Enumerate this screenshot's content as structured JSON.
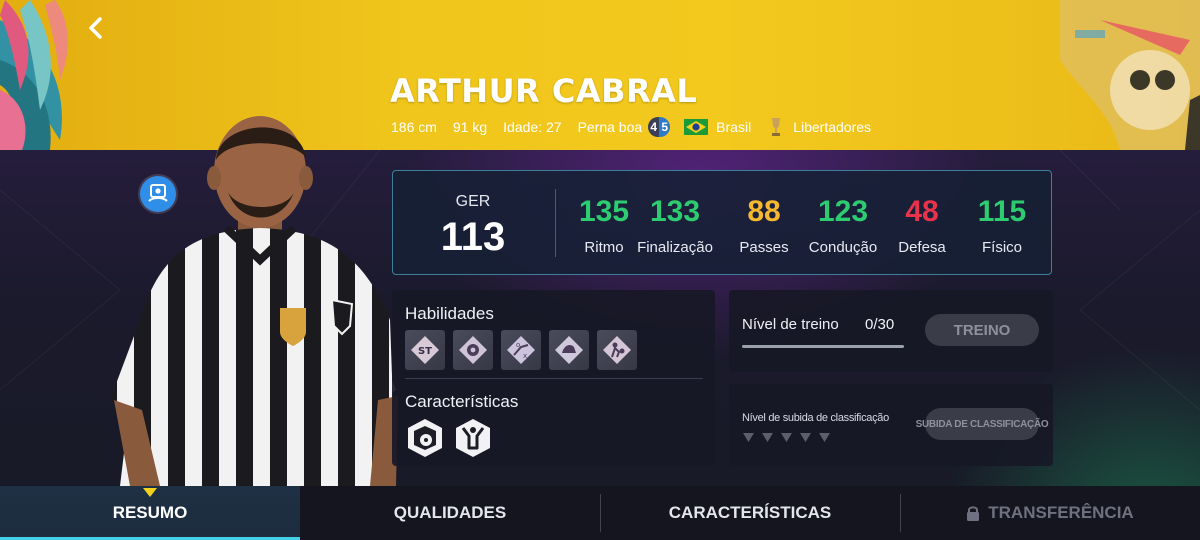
{
  "header": {
    "player_name": "ARTHUR CABRAL",
    "height": "186 cm",
    "weight": "91 kg",
    "age": "Idade: 27",
    "strong_foot_label": "Perna boa",
    "weak_foot": "4",
    "strong_foot": "5",
    "nationality": "Brasil",
    "league": "Libertadores"
  },
  "stats": {
    "overall_label": "GER",
    "overall_value": "113",
    "items": [
      {
        "value": "135",
        "label": "Ritmo",
        "color": "#2ecc71"
      },
      {
        "value": "133",
        "label": "Finalização",
        "color": "#2ecc71"
      },
      {
        "value": "88",
        "label": "Passes",
        "color": "#f5b82e"
      },
      {
        "value": "123",
        "label": "Condução",
        "color": "#2ecc71"
      },
      {
        "value": "48",
        "label": "Defesa",
        "color": "#e8334a"
      },
      {
        "value": "115",
        "label": "Físico",
        "color": "#2ecc71"
      }
    ]
  },
  "skills": {
    "title": "Habilidades",
    "tiles": [
      {
        "icon": "st-icon",
        "text": "ST"
      },
      {
        "icon": "ball-feint-icon",
        "text": ""
      },
      {
        "icon": "tactics-icon",
        "text": ""
      },
      {
        "icon": "arm-strength-icon",
        "text": ""
      },
      {
        "icon": "player-control-icon",
        "text": ""
      }
    ],
    "characteristics_title": "Características",
    "characteristics": [
      "ball-shield-icon",
      "celebration-icon"
    ]
  },
  "training": {
    "label": "Nível de treino",
    "count": "0/30",
    "progress": 0,
    "button": "TREINO"
  },
  "classification": {
    "label": "Nível de subida de classificação",
    "levels": 5,
    "button": "SUBIDA DE CLASSIFICAÇÃO"
  },
  "tabs": [
    {
      "label": "RESUMO",
      "active": true,
      "locked": false
    },
    {
      "label": "QUALIDADES",
      "active": false,
      "locked": false
    },
    {
      "label": "CARACTERÍSTICAS",
      "active": false,
      "locked": false
    },
    {
      "label": "TRANSFERÊNCIA",
      "active": false,
      "locked": true
    }
  ],
  "colors": {
    "banner_yellow": "#f0c61c",
    "panel_border": "#3d7f9a",
    "active_tab_accent": "#43d1e8"
  }
}
